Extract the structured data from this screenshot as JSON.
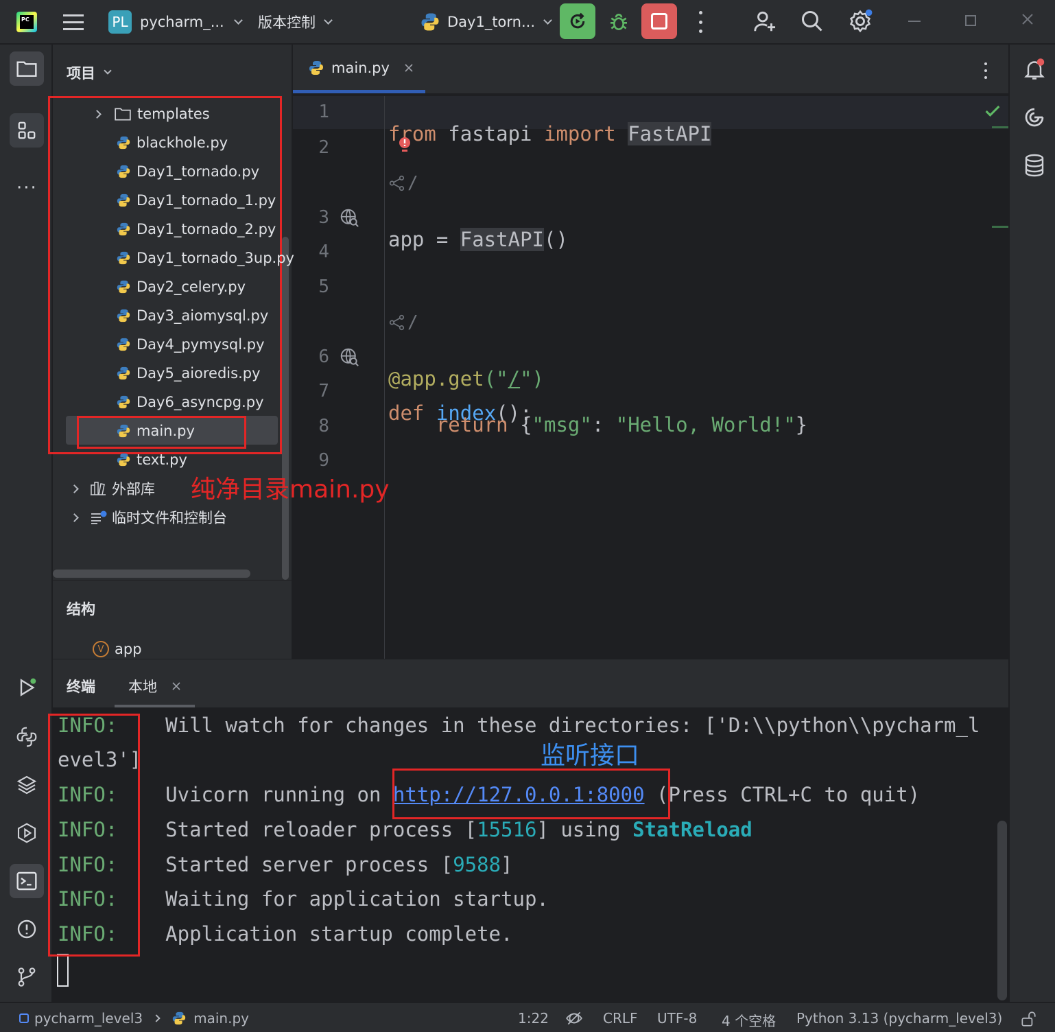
{
  "titlebar": {
    "project_badge": "PL",
    "project_name": "pycharm_...",
    "vcs_label": "版本控制",
    "run_config": "Day1_torn...",
    "colors": {
      "run_green": "#5fb865",
      "stop_red": "#db5c5c"
    }
  },
  "project_panel": {
    "title": "项目",
    "items": [
      {
        "label": "templates",
        "type": "folder"
      },
      {
        "label": "blackhole.py",
        "type": "py"
      },
      {
        "label": "Day1_tornado.py",
        "type": "py"
      },
      {
        "label": "Day1_tornado_1.py",
        "type": "py"
      },
      {
        "label": "Day1_tornado_2.py",
        "type": "py"
      },
      {
        "label": "Day1_tornado_3up.py",
        "type": "py"
      },
      {
        "label": "Day2_celery.py",
        "type": "py"
      },
      {
        "label": "Day3_aiomysql.py",
        "type": "py"
      },
      {
        "label": "Day4_pymysql.py",
        "type": "py"
      },
      {
        "label": "Day5_aioredis.py",
        "type": "py"
      },
      {
        "label": "Day6_asyncpg.py",
        "type": "py"
      },
      {
        "label": "main.py",
        "type": "py",
        "selected": true
      },
      {
        "label": "text.py",
        "type": "py"
      }
    ],
    "external_libs": "外部库",
    "scratches": "临时文件和控制台",
    "annotation": "纯净目录main.py"
  },
  "structure_panel": {
    "title": "结构",
    "item_badge": "V",
    "item": "app"
  },
  "editor": {
    "tab_label": "main.py",
    "line_numbers": [
      "1",
      "2",
      "3",
      "4",
      "5",
      "6",
      "7",
      "8",
      "9"
    ],
    "code": {
      "l1_kw1": "from",
      "l1_mod": " fastapi ",
      "l1_kw2": "import",
      "l1_name": "FastAPI",
      "slash": "/",
      "l3_a": "app = ",
      "l3_b": "FastAPI",
      "l3_c": "()",
      "l6_deco": "@app.get",
      "l6_open": "(\"",
      "l6_path": "/",
      "l6_close": "\")",
      "l7_kw": "def",
      "l7_fn": "index",
      "l7_rest": "():",
      "l8_kw": "return",
      "l8_open": " {",
      "l8_key": "\"msg\"",
      "l8_colon": ": ",
      "l8_val": "\"Hello, World!\"",
      "l8_close": "}"
    }
  },
  "terminal": {
    "tab_title": "终端",
    "tab_local": "本地",
    "info_label": "INFO:",
    "line1": "Will watch for changes in these directories: ['D:\\\\python\\\\pycharm_l",
    "line1_wrap": "evel3']",
    "line2_a": "Uvicorn running on ",
    "line2_url": "http://127.0.0.1:8000",
    "line2_b": " (Press CTRL+C to quit)",
    "line3_a": "Started reloader process [",
    "line3_pid": "15516",
    "line3_b": "] using ",
    "line3_reload": "StatReload",
    "line4_a": "Started server process [",
    "line4_pid": "9588",
    "line4_b": "]",
    "line5": "Waiting for application startup.",
    "line6": "Application startup complete.",
    "annotation": "监听接口"
  },
  "statusbar": {
    "project": "pycharm_level3",
    "file": "main.py",
    "position": "1:22",
    "line_sep": "CRLF",
    "encoding": "UTF-8",
    "indent": "4 个空格",
    "interpreter": "Python 3.13 (pycharm_level3)"
  }
}
